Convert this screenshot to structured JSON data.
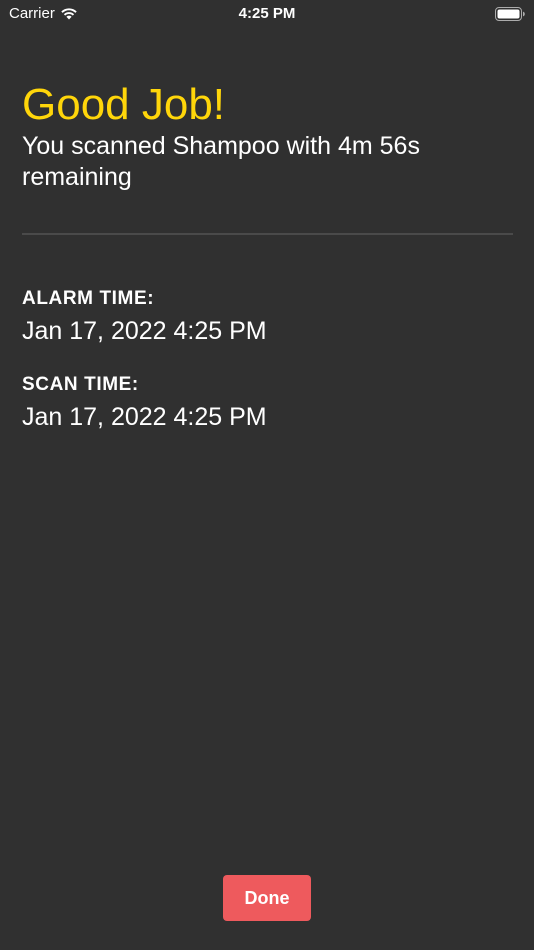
{
  "status_bar": {
    "carrier": "Carrier",
    "time": "4:25 PM",
    "icons": [
      "wifi-icon",
      "battery-icon"
    ]
  },
  "main": {
    "title": "Good Job!",
    "subtitle": "You scanned Shampoo with 4m 56s remaining",
    "fields": [
      {
        "label": "ALARM TIME:",
        "value": "Jan 17, 2022 4:25 PM"
      },
      {
        "label": "SCAN TIME:",
        "value": "Jan 17, 2022 4:25 PM"
      }
    ]
  },
  "actions": {
    "done_label": "Done"
  },
  "colors": {
    "background": "#303030",
    "title": "#ffd60a",
    "text": "#ffffff",
    "divider": "#4a4a4a",
    "button": "#ee5a5d"
  }
}
